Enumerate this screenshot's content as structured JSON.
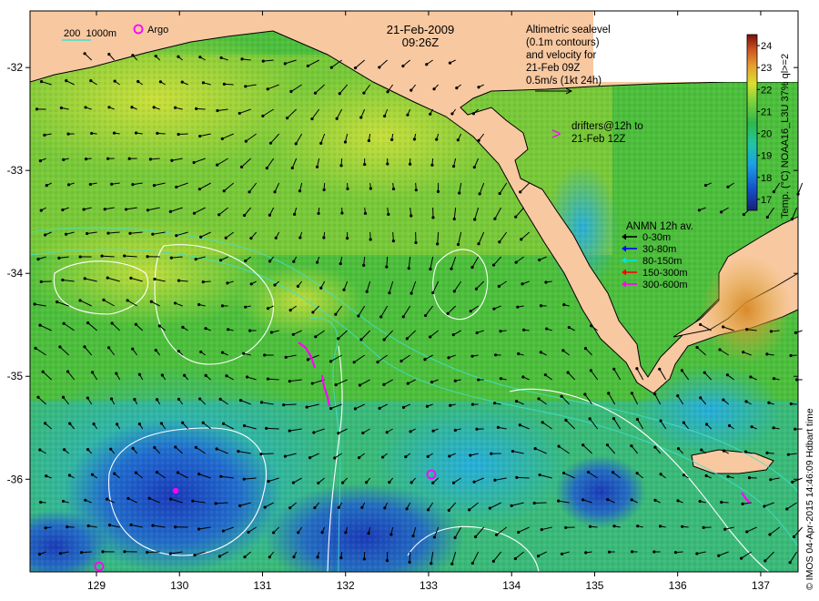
{
  "header": {
    "date": "21-Feb-2009",
    "time": "09:26Z"
  },
  "legend_topleft": {
    "isobath_label": "200  1000m",
    "argo_label": "Argo"
  },
  "altimetry_note": {
    "lines": [
      "Altimetric sealevel",
      "(0.1m contours)",
      "and velocity for",
      "21-Feb 09Z",
      "0.5m/s (1kt 24h)"
    ]
  },
  "drifters_note": {
    "symbol": ">",
    "lines": [
      "drifters@12h to",
      "21-Feb 12Z"
    ]
  },
  "anmn_legend": {
    "title": "ANMN 12h av.",
    "items": [
      {
        "label": "0-30m",
        "color": "#000000"
      },
      {
        "label": "30-80m",
        "color": "#0000ff"
      },
      {
        "label": "80-150m",
        "color": "#00e5e5"
      },
      {
        "label": "150-300m",
        "color": "#ff0000"
      },
      {
        "label": "300-600m",
        "color": "#ff00ff"
      }
    ]
  },
  "colorbar": {
    "title": "Temp. (°C) NOAA16_L3U 37% ql>=2",
    "ticks": [
      "17",
      "18",
      "19",
      "20",
      "21",
      "22",
      "23",
      "24"
    ],
    "min": 16.5,
    "max": 24.5,
    "colors": [
      "#1a1f7a",
      "#1450c8",
      "#1aa0e6",
      "#22c6a0",
      "#30b84a",
      "#7cd23c",
      "#d8e030",
      "#e8a030",
      "#c85020",
      "#7a1008"
    ]
  },
  "axes": {
    "lon_ticks": [
      "129",
      "130",
      "131",
      "132",
      "133",
      "134",
      "135",
      "136",
      "137"
    ],
    "lat_ticks": [
      "-32",
      "-33",
      "-34",
      "-35",
      "-36"
    ],
    "lon_range": [
      128.2,
      137.45
    ],
    "lat_range": [
      -36.9,
      -31.45
    ]
  },
  "credit": "© IMOS 04-Apr-2015 14:46:09 Hdbart time",
  "colors": {
    "land": "#f8c8a0",
    "sea_green": "#4cbf3c",
    "sea_yellow": "#c8dc3c",
    "sea_cyan": "#2ab7cf",
    "sea_blue": "#1f4fc8",
    "contour": "#ffffff",
    "isobath": "#40e0d0",
    "argo": "#ff00ff"
  }
}
